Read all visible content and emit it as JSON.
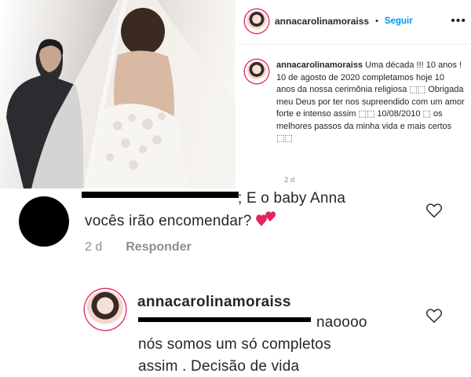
{
  "post": {
    "username": "annacarolinamoraiss",
    "separator": "•",
    "follow_label": "Seguir",
    "more_icon": "more-options-icon",
    "caption_username": "annacarolinamoraiss",
    "caption_body": "Uma década !!! 10 anos ! 10 de agosto de 2020 completamos hoje 10 anos da nossa cerimônia religiosa ⬚⬚ Obrigada meu Deus por ter nos supreendido com um amor forte e intenso assim ⬚⬚ 10/08/2010 ⬚ os melhores passos da minha vida e mais certos ⬚⬚",
    "time": "2 d"
  },
  "comments": [
    {
      "text_line1": "; E o baby Anna",
      "text_line2": "vocês irão encomendar?",
      "emoji": "two-hearts-emoji",
      "time": "2 d",
      "reply_label": "Responder",
      "like_icon": "heart-outline-icon"
    },
    {
      "username": "annacarolinamoraiss",
      "text_line1": "naoooo",
      "text_line2": "nós somos um só completos",
      "text_line3": "assim . Decisão de vida",
      "like_icon": "heart-outline-icon"
    }
  ],
  "colors": {
    "text": "#262626",
    "muted": "#8e8e8e",
    "link": "#0095f6",
    "emoji_heart": "#e0245e"
  }
}
